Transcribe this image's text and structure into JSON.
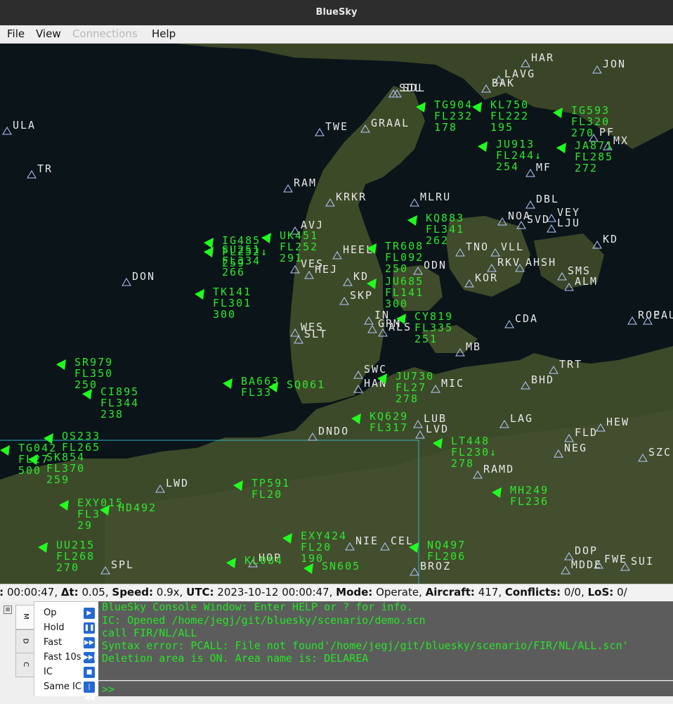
{
  "window": {
    "title": "BlueSky"
  },
  "menu": [
    {
      "label": "File",
      "enabled": true
    },
    {
      "label": "View",
      "enabled": true
    },
    {
      "label": "Connections",
      "enabled": false
    },
    {
      "label": "Help",
      "enabled": true
    }
  ],
  "colors": {
    "aircraft": "#20ff20",
    "aircraft_label": "#2ce82c",
    "waypoint_triangle": "#b8c8ff",
    "waypoint_label": "#e8e8e8",
    "sea": "#0b1419",
    "land": "#3d4a28",
    "deletion_area": "#2fb4c8",
    "console_bg": "#5c5c5c",
    "console_text": "#26e426"
  },
  "map": {
    "deletion_area_name": "DELAREA",
    "waypoints": [
      "SDL",
      "TWE",
      "GRAAL",
      "RAM",
      "KRKR",
      "HEEL",
      "MLRU",
      "AVJ",
      "VES",
      "HEJ",
      "KD",
      "SKP",
      "WES",
      "SLT",
      "IN",
      "GRM",
      "ALS",
      "SWC",
      "HAN",
      "MB",
      "ODN",
      "TNO",
      "VLL",
      "RKV",
      "NOA",
      "KOR",
      "CDA",
      "TRT",
      "BHD",
      "LAG",
      "FLD",
      "NEG",
      "LUB",
      "LVD",
      "DNDO",
      "MIC",
      "LWD",
      "SPL",
      "HOP",
      "NIE",
      "CEL",
      "BROZ",
      "FWE",
      "SUI",
      "DOP",
      "MDDE",
      "ULA",
      "TR",
      "DON",
      "HAR",
      "LAVG",
      "BAK",
      "JON",
      "PF",
      "MF",
      "MX",
      "DBL",
      "SVD",
      "VEY",
      "LJU",
      "KD",
      "ROE",
      "PAU",
      "SZC",
      "HEW",
      "RAMD",
      "SMS",
      "ALM",
      "AHSH",
      "SDL"
    ],
    "aircraft": [
      {
        "callsign": "TG904",
        "fl": "FL232",
        "spd": "178"
      },
      {
        "callsign": "KL750",
        "fl": "FL222",
        "spd": "195"
      },
      {
        "callsign": "IG593",
        "fl": "FL320",
        "spd": "270"
      },
      {
        "callsign": "JU913",
        "fl": "FL244↓",
        "spd": "254"
      },
      {
        "callsign": "JA871",
        "fl": "FL285",
        "spd": "272"
      },
      {
        "callsign": "IG485",
        "fl": "FL252↓",
        "spd": "259"
      },
      {
        "callsign": "SU251",
        "fl": "FL334",
        "spd": "266"
      },
      {
        "callsign": "UK451",
        "fl": "FL252",
        "spd": "291"
      },
      {
        "callsign": "KQ883",
        "fl": "FL341",
        "spd": "262"
      },
      {
        "callsign": "TR608",
        "fl": "FL092",
        "spd": "250"
      },
      {
        "callsign": "JU685",
        "fl": "FL141",
        "spd": "300"
      },
      {
        "callsign": "TK141",
        "fl": "FL301",
        "spd": "300"
      },
      {
        "callsign": "CY819",
        "fl": "FL335",
        "spd": "251"
      },
      {
        "callsign": "SR979",
        "fl": "FL350",
        "spd": "250"
      },
      {
        "callsign": "CI895",
        "fl": "FL344",
        "spd": "238"
      },
      {
        "callsign": "BA663",
        "fl": "FL33",
        "spd": ""
      },
      {
        "callsign": "SQ061",
        "fl": "",
        "spd": ""
      },
      {
        "callsign": "JU730",
        "fl": "FL27",
        "spd": "278"
      },
      {
        "callsign": "OS233",
        "fl": "FL265",
        "spd": ""
      },
      {
        "callsign": "TG042",
        "fl": "FL27",
        "spd": "500"
      },
      {
        "callsign": "SK854",
        "fl": "FL370",
        "spd": "259"
      },
      {
        "callsign": "KQ629",
        "fl": "FL317",
        "spd": ""
      },
      {
        "callsign": "LT448",
        "fl": "FL230↓",
        "spd": "278"
      },
      {
        "callsign": "TP591",
        "fl": "FL20",
        "spd": ""
      },
      {
        "callsign": "MH249",
        "fl": "FL236",
        "spd": ""
      },
      {
        "callsign": "EXY424",
        "fl": "FL20",
        "spd": "190"
      },
      {
        "callsign": "NQ497",
        "fl": "FL206",
        "spd": ""
      },
      {
        "callsign": "EXY015",
        "fl": "FL3",
        "spd": "29"
      },
      {
        "callsign": "HD492",
        "fl": "",
        "spd": ""
      },
      {
        "callsign": "UU215",
        "fl": "FL268",
        "spd": "270"
      },
      {
        "callsign": "KL084",
        "fl": "",
        "spd": ""
      },
      {
        "callsign": "SN605",
        "fl": "",
        "spd": ""
      }
    ]
  },
  "status": {
    "t": "00:00:47",
    "dt": "0.05",
    "speed": "0.9x",
    "utc": "2023-10-12 00:00:47",
    "mode": "Operate",
    "aircraft": "417",
    "conflicts": "0/0",
    "los": "0/"
  },
  "side_tabs": [
    "M",
    "D",
    "C"
  ],
  "sim_controls": [
    {
      "label": "Op",
      "icon": "play-icon"
    },
    {
      "label": "Hold",
      "icon": "pause-icon"
    },
    {
      "label": "Fast",
      "icon": "fast-forward-icon"
    },
    {
      "label": "Fast 10s",
      "icon": "skip-forward-icon"
    },
    {
      "label": "IC",
      "icon": "stop-icon"
    },
    {
      "label": "Same IC",
      "icon": "skip-back-icon"
    }
  ],
  "console": {
    "lines": [
      "BlueSky Console Window: Enter HELP or ? for info.",
      "IC: Opened /home/jegj/git/bluesky/scenario/demo.scn",
      "call FIR/NL/ALL",
      "Syntax error: PCALL: File not found'/home/jegj/git/bluesky/scenario/FIR/NL/ALL.scn'",
      "Deletion area is ON. Area name is: DELAREA"
    ],
    "prompt": ">>"
  }
}
